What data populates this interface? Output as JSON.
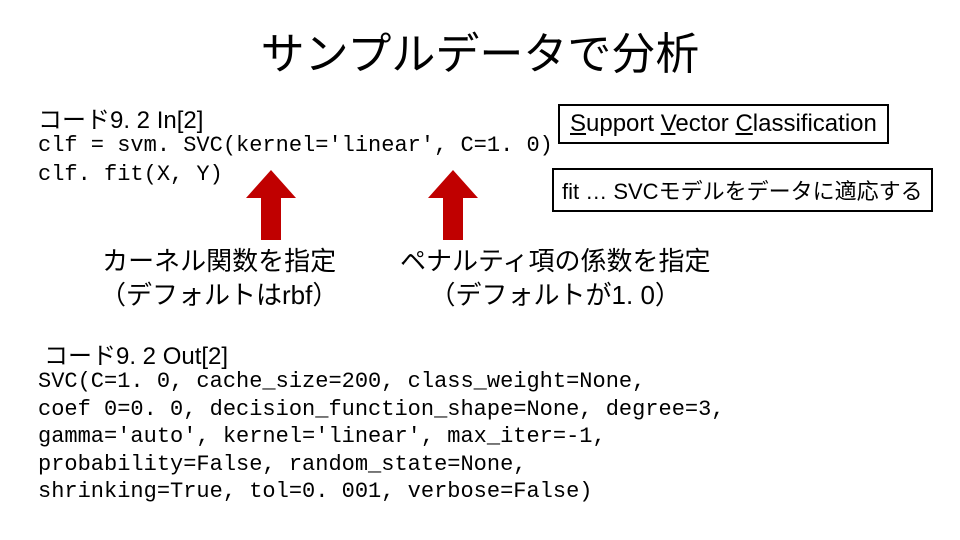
{
  "title": "サンプルデータで分析",
  "in_label": "コード9. 2 In[2]",
  "code_in": "clf = svm. SVC(kernel='linear', C=1. 0)\nclf. fit(X, Y)",
  "svc_box": {
    "s": "S",
    "rest1": "upport ",
    "v": "V",
    "rest2": "ector ",
    "c": "C",
    "rest3": "lassification"
  },
  "fit_box": "fit … SVCモデルをデータに適応する",
  "note1_l1": "カーネル関数を指定",
  "note1_l2": "（デフォルトはrbf）",
  "note2_l1": "ペナルティ項の係数を指定",
  "note2_l2": "（デフォルトが1. 0）",
  "out_label": "コード9. 2 Out[2]",
  "code_out": "SVC(C=1. 0, cache_size=200, class_weight=None,\ncoef 0=0. 0, decision_function_shape=None, degree=3,\ngamma='auto', kernel='linear', max_iter=-1,\nprobability=False, random_state=None,\nshrinking=True, tol=0. 001, verbose=False)"
}
